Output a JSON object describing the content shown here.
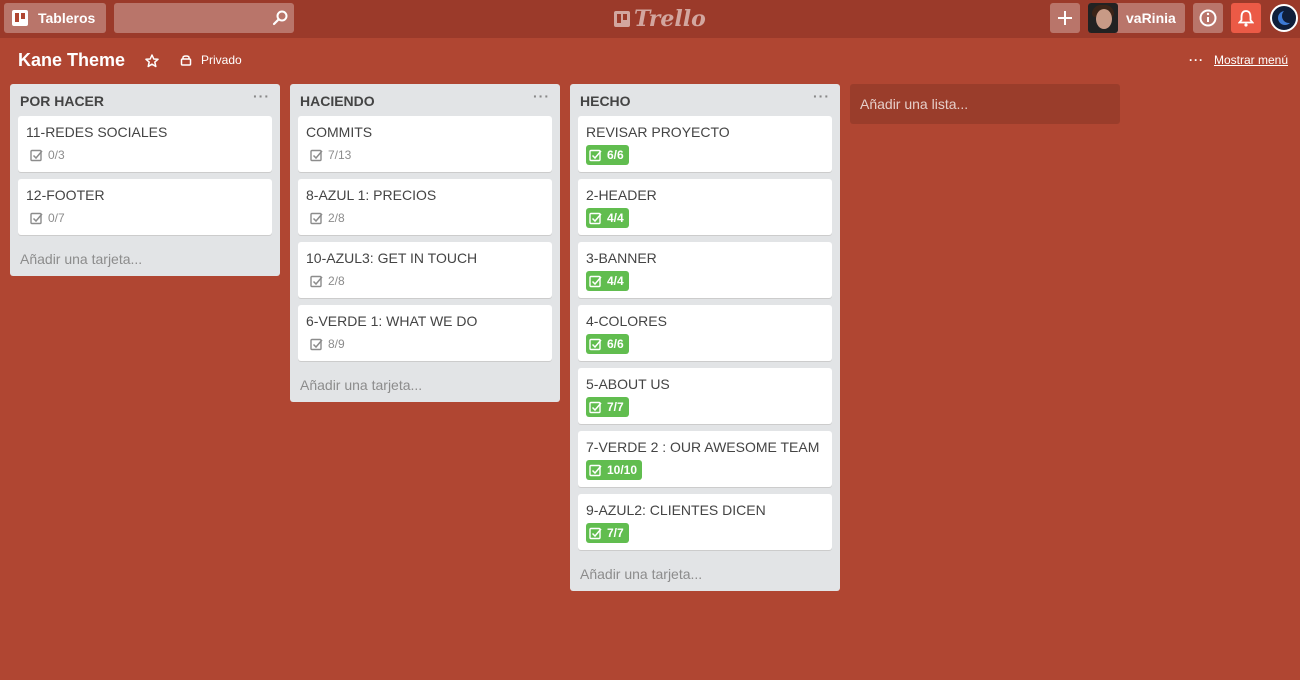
{
  "header": {
    "boards_label": "Tableros",
    "search_placeholder": "",
    "logo_text": "Trello",
    "user_name": "vaRinia"
  },
  "board": {
    "title": "Kane Theme",
    "privacy_label": "Privado",
    "menu_label": "Mostrar menú",
    "menu_dots": "···"
  },
  "lists": [
    {
      "title": "POR HACER",
      "menu": "···",
      "add_card": "Añadir una tarjeta...",
      "cards": [
        {
          "title": "11-REDES SOCIALES",
          "checklist": "0/3",
          "complete": false
        },
        {
          "title": "12-FOOTER",
          "checklist": "0/7",
          "complete": false
        }
      ]
    },
    {
      "title": "HACIENDO",
      "menu": "···",
      "add_card": "Añadir una tarjeta...",
      "cards": [
        {
          "title": "COMMITS",
          "checklist": "7/13",
          "complete": false
        },
        {
          "title": "8-AZUL 1: PRECIOS",
          "checklist": "2/8",
          "complete": false
        },
        {
          "title": "10-AZUL3: GET IN TOUCH",
          "checklist": "2/8",
          "complete": false
        },
        {
          "title": "6-VERDE 1: WHAT WE DO",
          "checklist": "8/9",
          "complete": false
        }
      ]
    },
    {
      "title": "HECHO",
      "menu": "···",
      "add_card": "Añadir una tarjeta...",
      "cards": [
        {
          "title": "REVISAR PROYECTO",
          "checklist": "6/6",
          "complete": true
        },
        {
          "title": "2-HEADER",
          "checklist": "4/4",
          "complete": true
        },
        {
          "title": "3-BANNER",
          "checklist": "4/4",
          "complete": true
        },
        {
          "title": "4-COLORES",
          "checklist": "6/6",
          "complete": true
        },
        {
          "title": "5-ABOUT US",
          "checklist": "7/7",
          "complete": true
        },
        {
          "title": "7-VERDE 2 : OUR AWESOME TEAM",
          "checklist": "10/10",
          "complete": true
        },
        {
          "title": "9-AZUL2: CLIENTES DICEN",
          "checklist": "7/7",
          "complete": true
        }
      ]
    }
  ],
  "add_list_label": "Añadir una lista...",
  "colors": {
    "background": "#b04632",
    "header": "#9b3a2a",
    "list": "#e2e4e6",
    "complete_badge": "#61bd4f",
    "notification": "#eb5a46"
  },
  "icons": [
    "boards-icon",
    "search-icon",
    "trello-logo-icon",
    "plus-icon",
    "info-icon",
    "bell-icon",
    "star-icon",
    "lock-icon",
    "checklist-icon"
  ]
}
